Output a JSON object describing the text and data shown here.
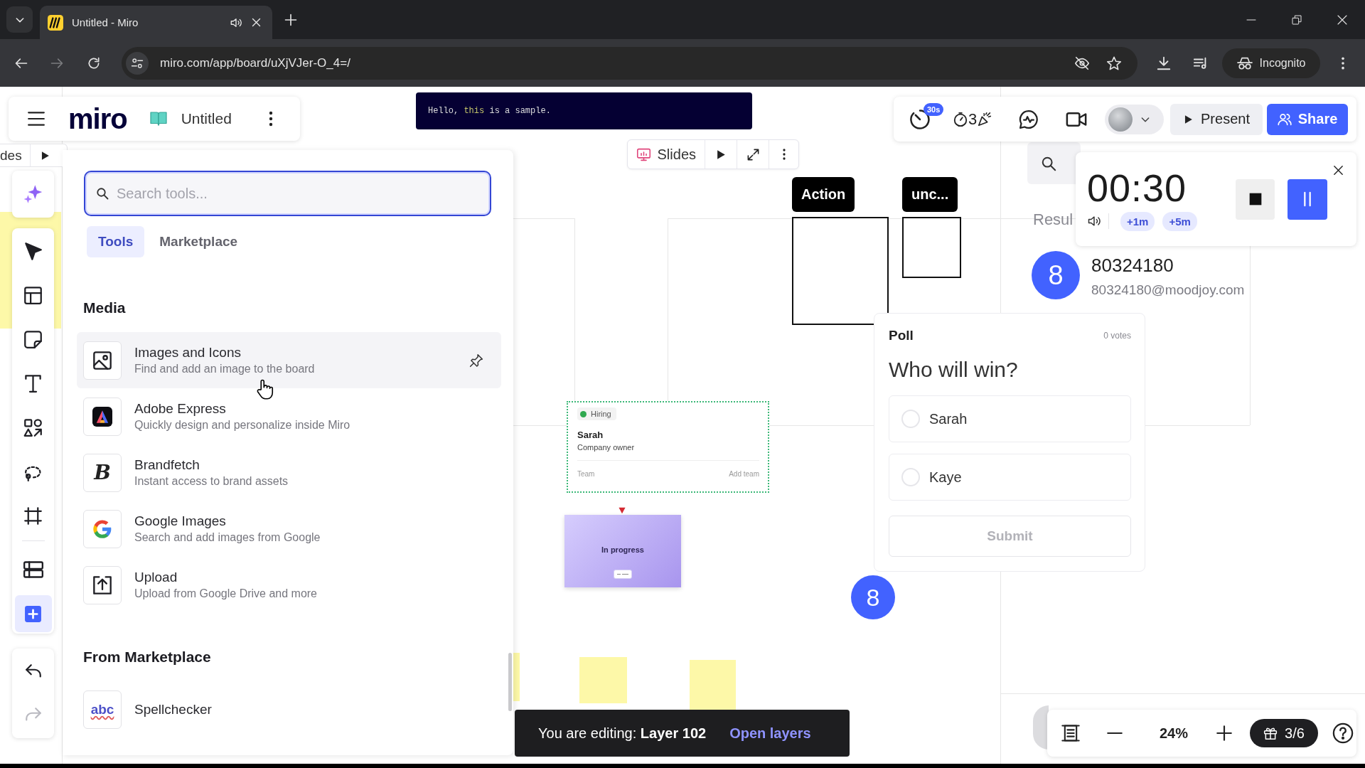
{
  "browser": {
    "tabs": [
      {
        "title": "Untitled - Miro",
        "selected": true,
        "playing_audio": true
      }
    ],
    "address": "miro.com/app/board/uXjVJer-O_4=/",
    "forward_enabled": false,
    "profile": "Incognito"
  },
  "board_header": {
    "logo": "miro",
    "title": "Untitled"
  },
  "code_banner": {
    "parts": [
      {
        "kind": "plain",
        "text": "Hello, "
      },
      {
        "kind": "keyword",
        "text": "this"
      },
      {
        "kind": "plain",
        "text": " is a sample."
      }
    ]
  },
  "top_toolbar": {
    "timer_badge": "30s",
    "countdown_digit": "3",
    "present": "Present",
    "share": "Share"
  },
  "slides_strip": {
    "label": "des"
  },
  "slides_bar": {
    "label": "Slides"
  },
  "left_toolbar": {
    "tools": [
      {
        "kind": "select",
        "selected": false
      },
      {
        "kind": "templates",
        "selected": false
      },
      {
        "kind": "sticky",
        "selected": false
      },
      {
        "kind": "text",
        "selected": false
      },
      {
        "kind": "shapes",
        "selected": false
      },
      {
        "kind": "lasso",
        "selected": false
      },
      {
        "kind": "frame",
        "selected": false
      }
    ],
    "apps": [
      {
        "kind": "table",
        "selected": false
      },
      {
        "kind": "more",
        "selected": true
      }
    ],
    "undo_enabled": true,
    "redo_enabled": false
  },
  "tools_panel": {
    "search": {
      "placeholder": "Search tools..."
    },
    "tabs": [
      {
        "label": "Tools",
        "selected": true
      },
      {
        "label": "Marketplace",
        "selected": false
      }
    ],
    "sections": [
      {
        "title": "Media",
        "items": [
          {
            "kind": "images",
            "name": "Images and Icons",
            "description": "Find and add an image to the board",
            "hovered": true
          },
          {
            "kind": "adobe",
            "name": "Adobe Express",
            "description": "Quickly design and personalize inside Miro",
            "hovered": false
          },
          {
            "kind": "brandfetch",
            "logo": "B",
            "name": "Brandfetch",
            "description": "Instant access to brand assets",
            "hovered": false
          },
          {
            "kind": "google",
            "name": "Google Images",
            "description": "Search and add images from Google",
            "hovered": false
          },
          {
            "kind": "upload",
            "name": "Upload",
            "description": "Upload from Google Drive and more",
            "hovered": false
          }
        ]
      },
      {
        "title": "From Marketplace",
        "items": [
          {
            "kind": "spellcheck",
            "logo": "abc",
            "name": "Spellchecker",
            "hovered": false
          }
        ]
      }
    ]
  },
  "canvas": {
    "tags": [
      {
        "text": "Action"
      },
      {
        "text": "unc..."
      }
    ],
    "hiring_card": {
      "status": "Hiring",
      "name": "Sarah",
      "role": "Company owner",
      "team_label": "Team",
      "team_action": "Add team"
    },
    "progress_card": {
      "label": "In progress"
    },
    "cursor_avatar": "8",
    "poll": {
      "title": "Poll",
      "votes": "0 votes",
      "question": "Who will win?",
      "options": [
        {
          "label": "Sarah",
          "selected": false
        },
        {
          "label": "Kaye",
          "selected": false
        }
      ],
      "submit": {
        "label": "Submit",
        "disabled": true
      }
    }
  },
  "editing_bar": {
    "message": "You are editing: **Layer 102**",
    "link": "Open layers"
  },
  "results_panel": {
    "heading": "Resul",
    "user": {
      "initial": "8",
      "name": "80324180",
      "email": "80324180@moodjoy.com"
    }
  },
  "timer": {
    "time": "00:30",
    "add_buttons": [
      "+1m",
      "+5m"
    ],
    "running": true
  },
  "zoom_bar": {
    "zoom": "24%",
    "gifts": "3/6"
  }
}
